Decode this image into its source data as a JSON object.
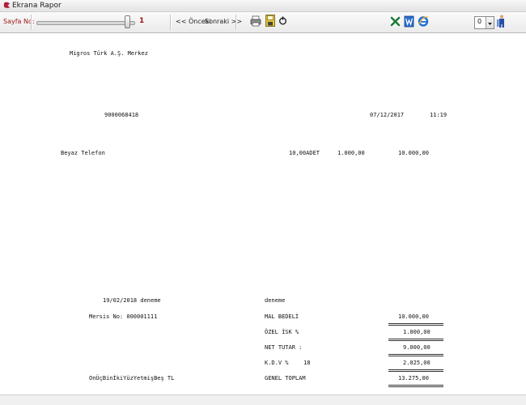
{
  "window": {
    "title": "Ekrana Rapor"
  },
  "toolbar": {
    "page_label": "Sayfa No:",
    "page_number": "1",
    "page_slider_level": 0.95,
    "prev_label": "<< Önceki",
    "next_label": "Sonraki >>",
    "zoom_value": "0"
  },
  "report": {
    "company": "Migros Türk A.Ş. Merkez",
    "document_no": "9000068418",
    "date": "07/12/2017",
    "time": "11:19",
    "line_items": [
      {
        "product": "Beyaz Telefon",
        "quantity": "10,00ADET",
        "unit_price": "1.000,00",
        "total": "10.000,00"
      }
    ],
    "footer_date_note": "19/02/2018 deneme",
    "footer_note": "deneme",
    "mersis": "Mersis No: 000001111",
    "amount_in_words": "OnÜçBinİkiYüzYetmişBeş TL",
    "totals": {
      "mal_bedeli_label": "MAL BEDELİ",
      "mal_bedeli_value": "10.000,00",
      "ozel_isk_label": "ÖZEL İSK %",
      "ozel_isk_value": "1.000,00",
      "net_tutar_label": "NET TUTAR :",
      "net_tutar_value": "9.000,00",
      "kdv_label": "K.D.V %",
      "kdv_rate": "18",
      "kdv_value": "2.025,00",
      "genel_toplam_label": "GENEL TOPLAM",
      "genel_toplam_value": "13.275,00"
    }
  },
  "colors": {
    "accent_red": "#a01818",
    "report_text": "#111111"
  },
  "icons": [
    "app-icon",
    "print-icon",
    "save-icon",
    "refresh-icon",
    "excel-icon",
    "word-icon",
    "ie-icon",
    "exit-icon"
  ]
}
